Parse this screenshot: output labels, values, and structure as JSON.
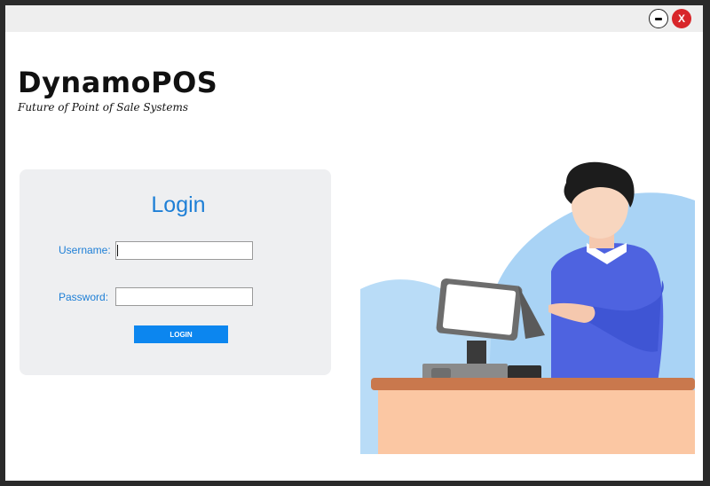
{
  "window": {
    "minimize_label": "–",
    "close_label": "X",
    "close_color": "#d8262a"
  },
  "brand": {
    "name": "DynamoPOS",
    "tagline": "Future of Point of Sale Systems"
  },
  "login": {
    "title": "Login",
    "username_label": "Username:",
    "username_value": "",
    "password_label": "Password:",
    "password_value": "",
    "button_label": "LOGIN",
    "accent_color": "#1e7fd6",
    "button_color": "#0c86ef"
  },
  "illustration": {
    "icon": "cashier-at-pos-illustration"
  }
}
